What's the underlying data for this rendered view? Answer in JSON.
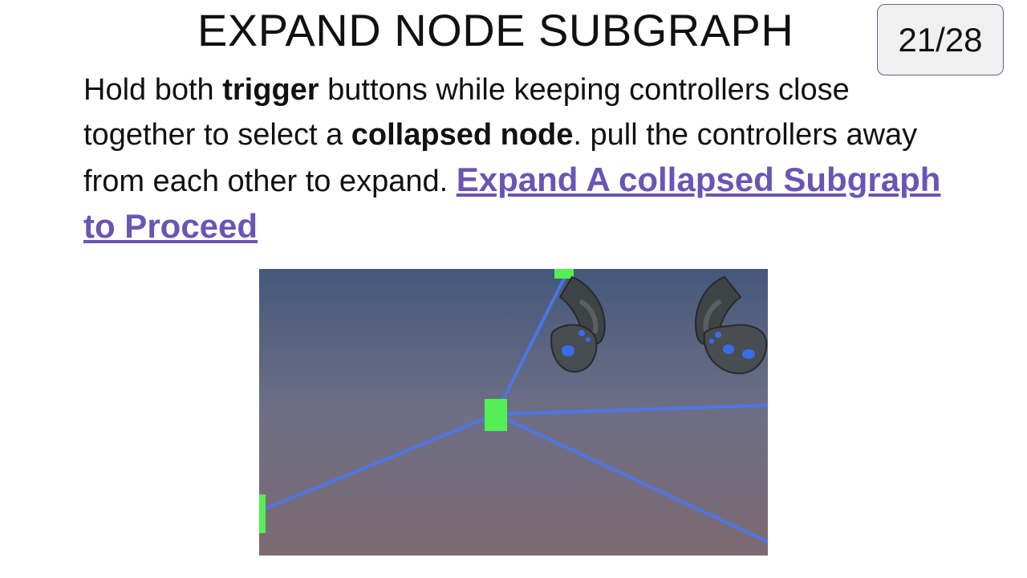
{
  "slide": {
    "title": "EXPAND NODE SUBGRAPH",
    "counter": "21/28"
  },
  "instructions": {
    "part1": "Hold both ",
    "trigger": "trigger",
    "part2": " buttons while keeping controllers close together to select a ",
    "collapsed_node": "collapsed node",
    "part3": ". pull the controllers away from each other to expand. ",
    "link": "Expand A collapsed Subgraph to Proceed"
  },
  "colors": {
    "link": "#6a55b4",
    "node": "#55ee55",
    "edge": "#4a78f0"
  },
  "scene": {
    "description_icon": "vr-scene-image"
  }
}
